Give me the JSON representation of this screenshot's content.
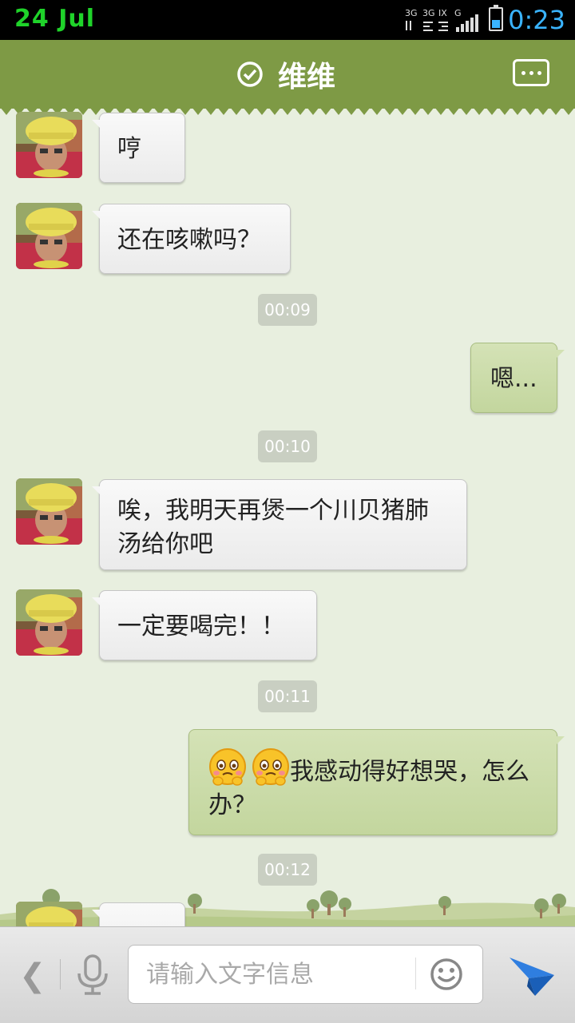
{
  "status_bar": {
    "date": "24  Jul",
    "time": "0:23",
    "signal_labels": [
      "3G",
      "3G",
      "IX",
      "G"
    ],
    "battery_level": 0.4
  },
  "header": {
    "title": "维维",
    "verified_icon": "check-circle-icon",
    "menu_icon": "more-options-icon"
  },
  "messages": [
    {
      "type": "in",
      "text": "哼"
    },
    {
      "type": "in",
      "text": "还在咳嗽吗？"
    },
    {
      "type": "time",
      "text": "00:09"
    },
    {
      "type": "out",
      "text": "嗯..."
    },
    {
      "type": "time",
      "text": "00:10"
    },
    {
      "type": "in",
      "text": "唉，我明天再煲一个川贝猪肺汤给你吧"
    },
    {
      "type": "in",
      "text": "一定要喝完！！"
    },
    {
      "type": "time",
      "text": "00:11"
    },
    {
      "type": "out",
      "emojis": [
        "crying-face-emoji",
        "crying-face-emoji"
      ],
      "text": "我感动得好想哭，怎么办？"
    },
    {
      "type": "time",
      "text": "00:12"
    },
    {
      "type": "in",
      "text": ""
    }
  ],
  "input_bar": {
    "placeholder": "请输入文字信息",
    "back_icon": "chevron-left-icon",
    "mic_icon": "microphone-icon",
    "emoji_icon": "smiley-icon",
    "send_icon": "send-icon"
  },
  "colors": {
    "header_bg": "#7e9a45",
    "chat_bg": "#e8efdf",
    "outgoing_bubble": "#cbdca8",
    "incoming_bubble": "#f3f3f3",
    "timestamp_bg": "#c9cfc2"
  }
}
